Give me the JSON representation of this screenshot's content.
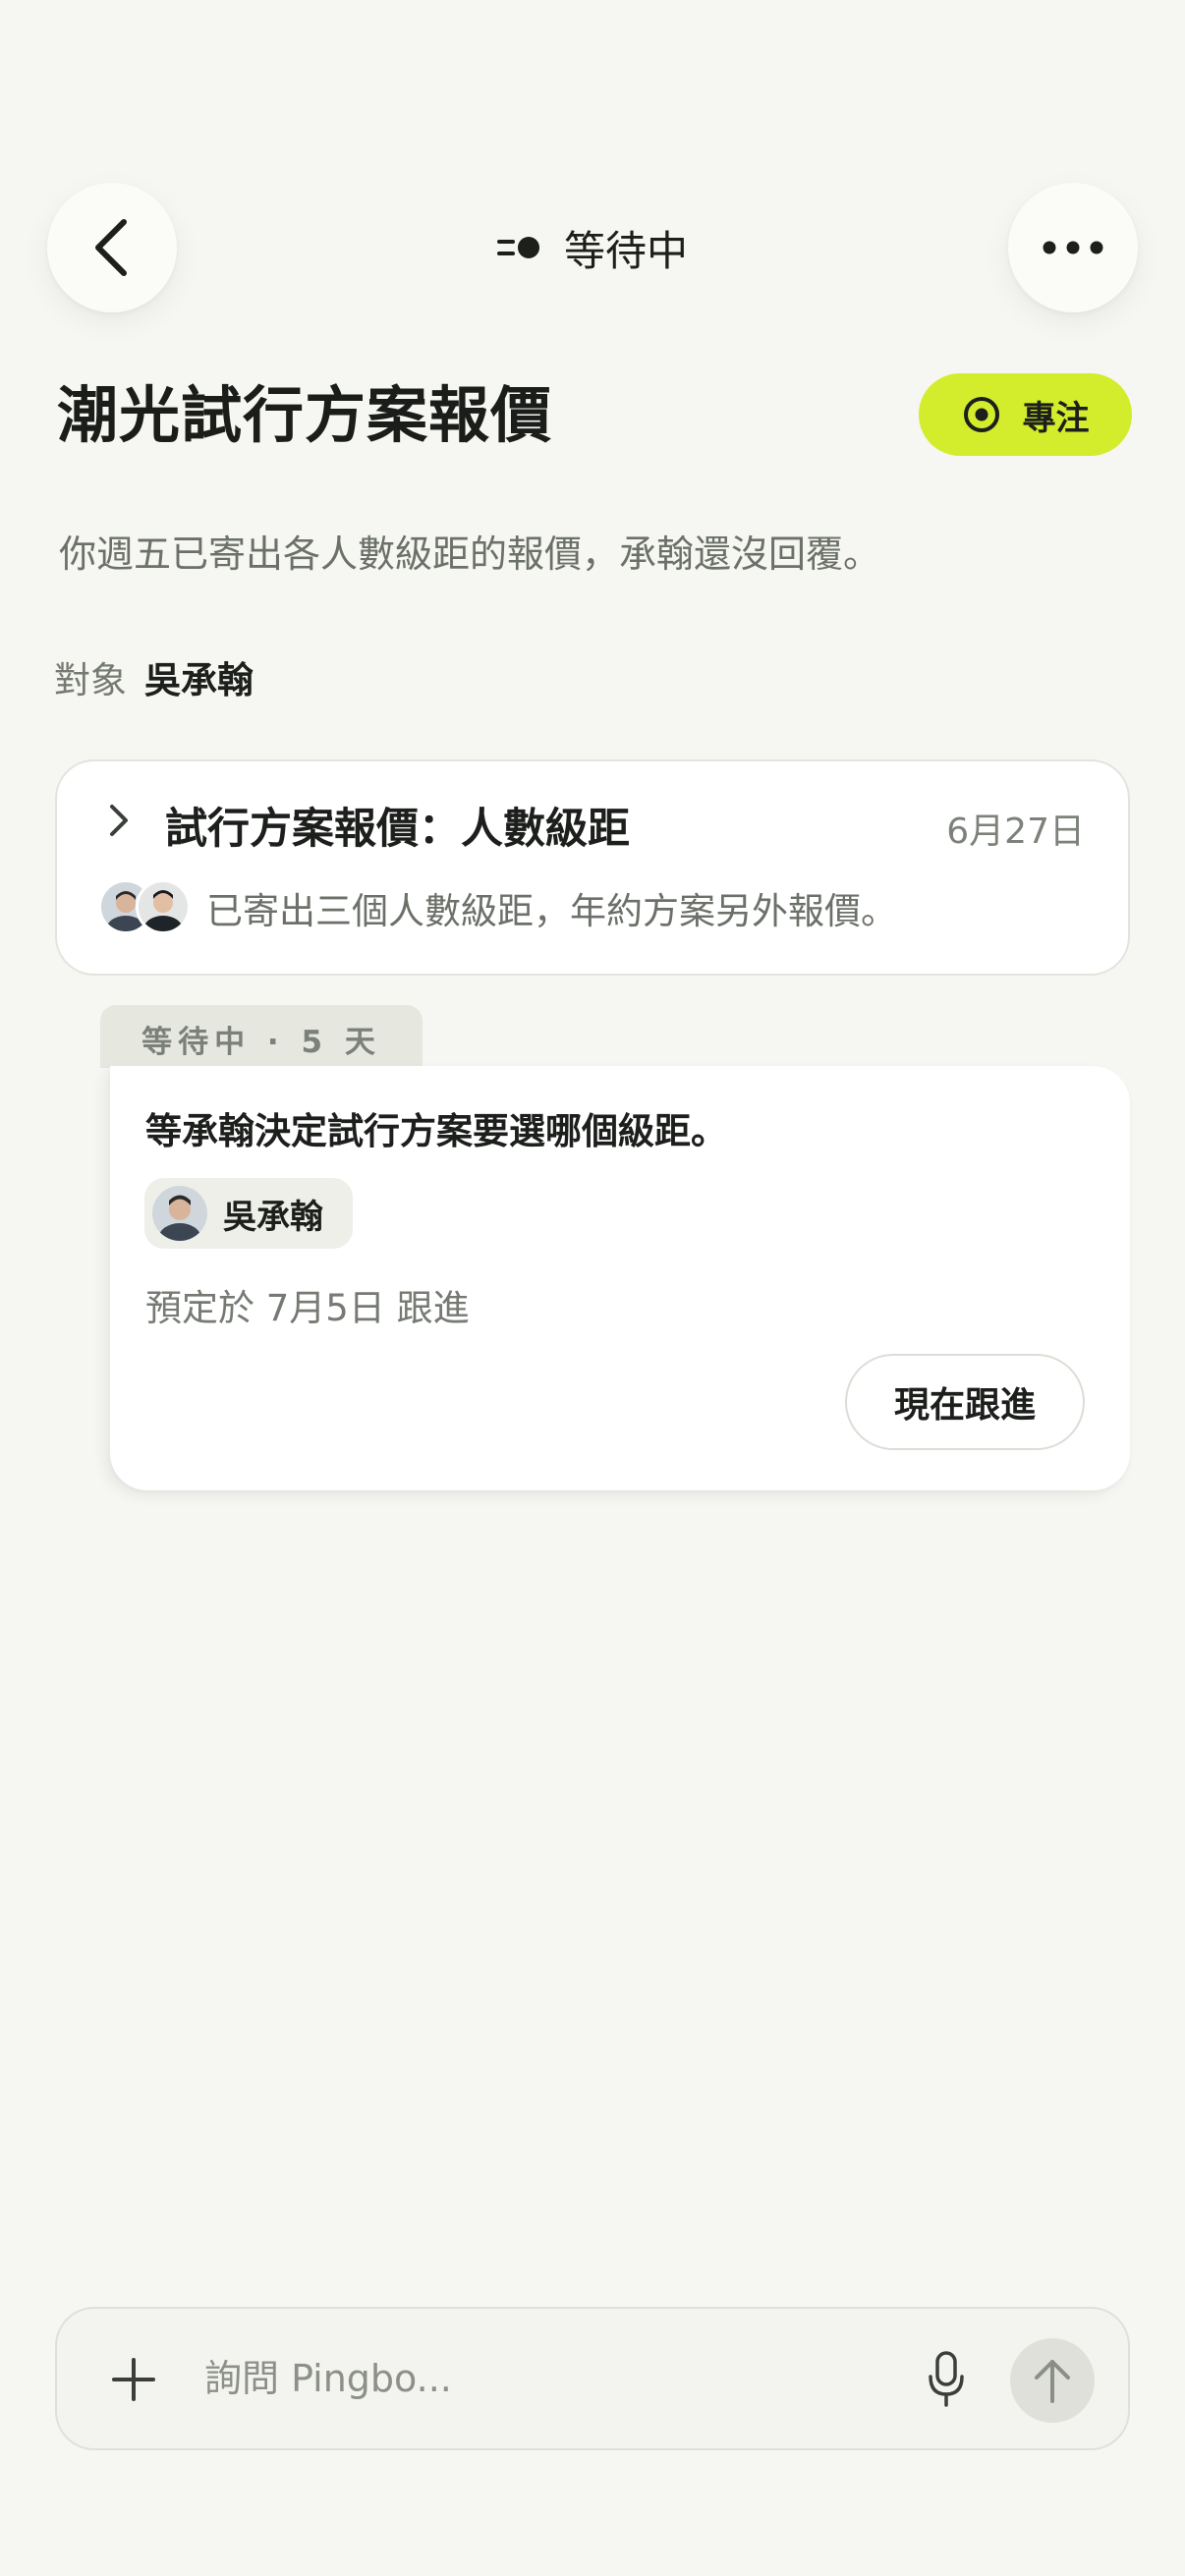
{
  "header": {
    "back_icon": "chevron-left-icon",
    "status_icon": "waiting-dot-icon",
    "status_label": "等待中",
    "more_icon": "ellipsis-icon"
  },
  "task": {
    "title": "潮光試行方案報價",
    "focus_label": "專注",
    "focus_color": "#d3ec2c",
    "summary": "你週五已寄出各人數級距的報價，承翰還沒回覆。",
    "target_label": "對象",
    "target_name": "吳承翰"
  },
  "thread": {
    "title": "試行方案報價：人數級距",
    "date": "6月27日",
    "subtitle": "已寄出三個人數級距，年約方案另外報價。"
  },
  "waiting": {
    "tab_label": "等待中 · 5 天",
    "title": "等承翰決定試行方案要選哪個級距。",
    "person_name": "吳承翰",
    "followup_text": "預定於 7月5日 跟進",
    "followup_button": "現在跟進"
  },
  "composer": {
    "placeholder": "詢問 Pingbo...",
    "value": ""
  }
}
